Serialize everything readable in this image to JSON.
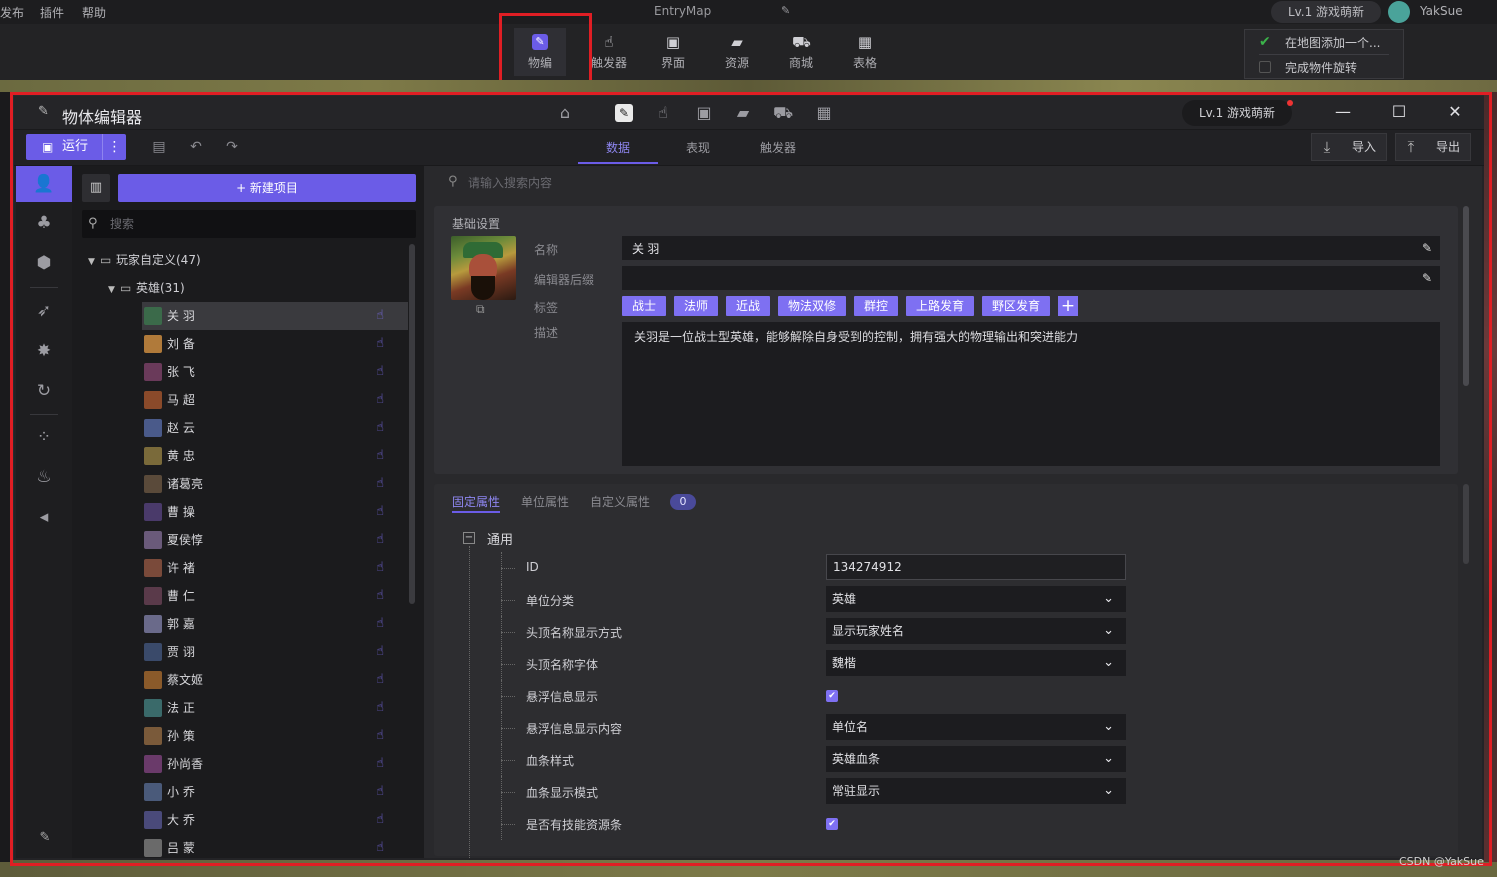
{
  "topbar": {
    "menus": [
      "发布",
      "插件",
      "帮助"
    ],
    "app_title": "EntryMap",
    "level_badge": "Lv.1 游戏萌新",
    "user_name": "YakSue"
  },
  "toolbar": {
    "buttons": [
      {
        "label": "物编",
        "icon": "object-edit-icon"
      },
      {
        "label": "触发器",
        "icon": "hand-pointer-icon"
      },
      {
        "label": "界面",
        "icon": "ui-icon"
      },
      {
        "label": "资源",
        "icon": "folder-icon"
      },
      {
        "label": "商城",
        "icon": "cart-icon"
      },
      {
        "label": "表格",
        "icon": "grid-icon"
      }
    ]
  },
  "notify": {
    "items": [
      {
        "text": "在地图添加一个...",
        "done": true
      },
      {
        "text": "完成物件旋转",
        "done": false
      }
    ]
  },
  "window": {
    "title": "物体编辑器",
    "level_badge": "Lv.1 游戏萌新",
    "run_label": "运行",
    "tabs": [
      "数据",
      "表现",
      "触发器"
    ],
    "active_tab": "数据",
    "import_label": "导入",
    "export_label": "导出"
  },
  "list": {
    "new_button": "+ 新建项目",
    "search_placeholder": "搜索",
    "root_folder": "玩家自定义(47)",
    "sub_folder": "英雄(31)",
    "heroes": [
      "关 羽",
      "刘 备",
      "张 飞",
      "马 超",
      "赵 云",
      "黄 忠",
      "诸葛亮",
      "曹 操",
      "夏侯惇",
      "许 褚",
      "曹 仁",
      "郭 嘉",
      "贾 诩",
      "蔡文姬",
      "法 正",
      "孙 策",
      "孙尚香",
      "小 乔",
      "大 乔",
      "吕 蒙"
    ],
    "selected": "关 羽"
  },
  "detail": {
    "search_placeholder": "请输入搜索内容",
    "basic_title": "基础设置",
    "name_label": "名称",
    "name_value": "关 羽",
    "suffix_label": "编辑器后缀",
    "suffix_value": "",
    "tags_label": "标签",
    "tags": [
      "战士",
      "法师",
      "近战",
      "物法双修",
      "群控",
      "上路发育",
      "野区发育"
    ],
    "desc_label": "描述",
    "desc_value": "关羽是一位战士型英雄，能够解除自身受到的控制，拥有强大的物理输出和突进能力"
  },
  "props": {
    "tabs": [
      "固定属性",
      "单位属性",
      "自定义属性"
    ],
    "custom_count": "0",
    "group_label": "通用",
    "rows": [
      {
        "label": "ID",
        "type": "text",
        "value": "134274912"
      },
      {
        "label": "单位分类",
        "type": "select",
        "value": "英雄"
      },
      {
        "label": "头顶名称显示方式",
        "type": "select",
        "value": "显示玩家姓名"
      },
      {
        "label": "头顶名称字体",
        "type": "select",
        "value": "魏楷"
      },
      {
        "label": "悬浮信息显示",
        "type": "check",
        "value": true
      },
      {
        "label": "悬浮信息显示内容",
        "type": "select",
        "value": "单位名"
      },
      {
        "label": "血条样式",
        "type": "select",
        "value": "英雄血条"
      },
      {
        "label": "血条显示模式",
        "type": "select",
        "value": "常驻显示"
      },
      {
        "label": "是否有技能资源条",
        "type": "check",
        "value": true
      }
    ]
  },
  "watermark": "CSDN @YakSue",
  "colors": {
    "accent": "#6b5ce7",
    "highlight": "#e01e24"
  }
}
